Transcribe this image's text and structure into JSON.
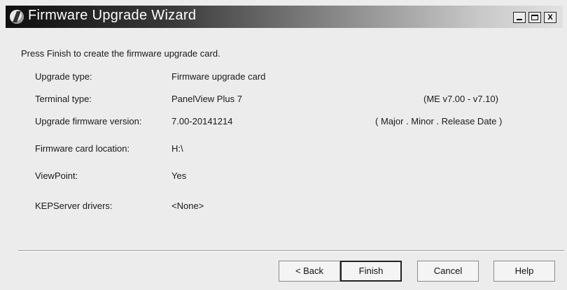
{
  "window": {
    "title": "Firmware Upgrade Wizard",
    "controls": {
      "minimize": "_",
      "maximize": "",
      "close": "X"
    }
  },
  "content": {
    "instruction": "Press Finish to create the firmware upgrade card.",
    "rows": [
      {
        "label": "Upgrade type:",
        "value": "Firmware upgrade card",
        "note": ""
      },
      {
        "label": "Terminal type:",
        "value": "PanelView Plus 7",
        "note": "(ME v7.00 - v7.10)"
      },
      {
        "label": "Upgrade firmware version:",
        "value": "7.00-20141214",
        "note": "( Major . Minor . Release Date )"
      },
      {
        "label": "Firmware card location:",
        "value": "H:\\",
        "note": ""
      },
      {
        "label": "ViewPoint:",
        "value": "Yes",
        "note": ""
      },
      {
        "label": "KEPServer drivers:",
        "value": "<None>",
        "note": ""
      }
    ]
  },
  "buttons": {
    "back": "< Back",
    "finish": "Finish",
    "cancel": "Cancel",
    "help": "Help"
  },
  "icons": {
    "app": "firmware-wizard-icon"
  }
}
